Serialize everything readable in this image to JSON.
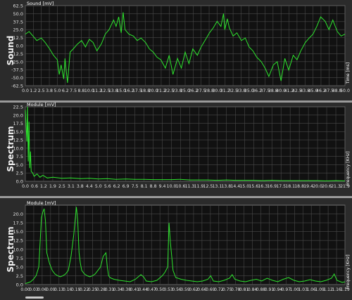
{
  "charts": [
    {
      "sidebar_label": "Sound",
      "chart_data": {
        "type": "line",
        "ylabel": "Sound [mV]",
        "xlabel": "Time [ms]",
        "ylim": [
          -62.5,
          62.5
        ],
        "yticks": [
          62.5,
          50.0,
          37.5,
          25.0,
          12.5,
          0.0,
          -12.5,
          -25.0,
          -37.5,
          -50.0,
          -62.5
        ],
        "xlim": [
          0,
          50.0
        ],
        "xticks": [
          "0.0",
          "1.2",
          "2.5",
          "3.8",
          "5.0",
          "6.2",
          "7.5",
          "8.8",
          "10.0",
          "11.2",
          "12.5",
          "13.8",
          "15.0",
          "16.2",
          "17.5",
          "18.8",
          "20.0",
          "21.2",
          "22.5",
          "23.8",
          "25.0",
          "26.2",
          "27.5",
          "28.8",
          "30.0",
          "31.2",
          "32.5",
          "33.8",
          "35.0",
          "36.2",
          "37.5",
          "38.8",
          "40.0",
          "41.2",
          "42.5",
          "43.8",
          "45.0",
          "46.2",
          "47.5",
          "48.8",
          "50.0"
        ],
        "grid": true,
        "line_color": "#2ee52e",
        "x": [
          0,
          0.6,
          1.2,
          1.8,
          2.5,
          3.1,
          3.8,
          4.4,
          5.0,
          5.3,
          5.6,
          6.0,
          6.2,
          6.6,
          7.0,
          7.5,
          8.1,
          8.8,
          9.4,
          10.0,
          10.6,
          11.2,
          11.9,
          12.5,
          13.1,
          13.8,
          14.2,
          14.6,
          15.0,
          15.3,
          15.6,
          16.2,
          16.9,
          17.5,
          18.1,
          18.8,
          19.4,
          20.0,
          20.6,
          21.2,
          21.9,
          22.5,
          23.1,
          23.8,
          24.4,
          25.0,
          25.6,
          26.2,
          26.9,
          27.5,
          28.1,
          28.8,
          29.4,
          30.0,
          30.6,
          31.0,
          31.2,
          31.6,
          31.9,
          32.5,
          33.1,
          33.8,
          34.4,
          35.0,
          35.6,
          36.2,
          36.9,
          37.5,
          38.1,
          38.8,
          39.4,
          40.0,
          40.6,
          41.2,
          41.9,
          42.5,
          43.1,
          43.8,
          44.4,
          45.0,
          45.6,
          46.2,
          46.9,
          47.5,
          48.1,
          48.8,
          49.4,
          50.0
        ],
        "y": [
          18,
          22,
          15,
          8,
          12,
          5,
          -5,
          -15,
          -22,
          -45,
          -30,
          -52,
          -20,
          -58,
          -10,
          -5,
          2,
          8,
          -2,
          10,
          5,
          -8,
          3,
          18,
          25,
          40,
          30,
          45,
          20,
          52,
          25,
          18,
          15,
          8,
          12,
          5,
          -5,
          -10,
          -18,
          -22,
          -35,
          -15,
          -45,
          -20,
          -35,
          -10,
          -28,
          -5,
          -15,
          -2,
          8,
          20,
          28,
          38,
          30,
          50,
          25,
          42,
          28,
          15,
          20,
          8,
          12,
          -2,
          -8,
          -18,
          -25,
          -35,
          -48,
          -30,
          -25,
          -55,
          -20,
          -38,
          -15,
          -22,
          -8,
          5,
          12,
          18,
          30,
          45,
          38,
          25,
          40,
          22,
          15,
          18
        ]
      }
    },
    {
      "sidebar_label": "Spectrum",
      "chart_data": {
        "type": "line",
        "ylabel": "Module [mV]",
        "xlabel": "Frequency [KHz]",
        "ylim": [
          0,
          22.5
        ],
        "yticks": [
          22.5,
          20.0,
          17.5,
          15.0,
          12.5,
          10.0,
          7.5,
          5.0,
          2.5,
          0.0
        ],
        "xlim": [
          0,
          21.9
        ],
        "xticks": [
          "0.0",
          "0.6",
          "1.2",
          "1.9",
          "2.5",
          "3.1",
          "3.8",
          "4.4",
          "5.0",
          "5.6",
          "6.2",
          "6.9",
          "7.5",
          "8.1",
          "8.8",
          "9.4",
          "10.0",
          "10.6",
          "11.3",
          "11.9",
          "12.5",
          "13.1",
          "13.8",
          "14.4",
          "15.0",
          "15.6",
          "16.3",
          "16.9",
          "17.5",
          "18.1",
          "18.8",
          "19.4",
          "20.0",
          "20.6",
          "21.3",
          "21.9"
        ],
        "grid": true,
        "line_color": "#2ee52e",
        "x": [
          0,
          0.1,
          0.15,
          0.2,
          0.25,
          0.3,
          0.35,
          0.4,
          0.5,
          0.6,
          0.8,
          1.0,
          1.2,
          1.5,
          1.9,
          2.5,
          3.1,
          3.8,
          4.4,
          5.0,
          5.6,
          6.2,
          6.9,
          7.5,
          8.1,
          8.8,
          9.4,
          10.0,
          10.6,
          11.3,
          11.9,
          12.5,
          13.1,
          13.8,
          14.4,
          15.0,
          15.6,
          16.3,
          16.9,
          17.5,
          18.1,
          18.8,
          19.4,
          20.0,
          20.6,
          21.3,
          21.9
        ],
        "y": [
          21.5,
          12,
          22.5,
          6,
          18,
          4,
          9,
          3,
          2.5,
          1.5,
          2.2,
          1.2,
          1.8,
          1.0,
          1.2,
          0.9,
          1.0,
          0.8,
          0.9,
          0.7,
          0.8,
          0.6,
          0.7,
          0.6,
          0.6,
          0.5,
          0.5,
          0.5,
          0.6,
          0.4,
          0.4,
          0.4,
          0.3,
          0.4,
          0.3,
          0.3,
          0.3,
          0.2,
          0.3,
          0.2,
          0.2,
          0.2,
          0.2,
          0.2,
          0.1,
          0.2,
          0.1
        ]
      }
    },
    {
      "sidebar_label": "Spectrum",
      "chart_data": {
        "type": "line",
        "ylabel": "Module [mV]",
        "xlabel": "Frequency [KHz]",
        "ylim": [
          0,
          22.5
        ],
        "yticks": [
          20.0,
          17.5,
          15.0,
          12.5,
          10.0,
          7.5,
          5.0,
          2.5,
          0.0
        ],
        "xlim": [
          0,
          1.19
        ],
        "xticks": [
          "0.00",
          "0.03",
          "0.06",
          "0.09",
          "0.13",
          "0.16",
          "0.19",
          "0.22",
          "0.25",
          "0.28",
          "0.31",
          "0.34",
          "0.38",
          "0.41",
          "0.44",
          "0.47",
          "0.50",
          "0.53",
          "0.56",
          "0.59",
          "0.62",
          "0.66",
          "0.69",
          "0.72",
          "0.75",
          "0.78",
          "0.81",
          "0.84",
          "0.88",
          "0.91",
          "0.94",
          "0.97",
          "1.00",
          "1.03",
          "1.06",
          "1.09",
          "1.12",
          "1.16",
          "1.19"
        ],
        "grid": true,
        "line_color": "#2ee52e",
        "x": [
          0,
          0.01,
          0.02,
          0.03,
          0.04,
          0.05,
          0.055,
          0.06,
          0.065,
          0.07,
          0.075,
          0.08,
          0.09,
          0.1,
          0.11,
          0.12,
          0.13,
          0.14,
          0.15,
          0.16,
          0.17,
          0.18,
          0.19,
          0.195,
          0.2,
          0.205,
          0.21,
          0.22,
          0.23,
          0.24,
          0.25,
          0.26,
          0.27,
          0.28,
          0.29,
          0.3,
          0.305,
          0.31,
          0.315,
          0.32,
          0.33,
          0.35,
          0.37,
          0.39,
          0.41,
          0.43,
          0.44,
          0.45,
          0.47,
          0.49,
          0.51,
          0.52,
          0.53,
          0.535,
          0.54,
          0.55,
          0.56,
          0.58,
          0.6,
          0.62,
          0.64,
          0.66,
          0.68,
          0.69,
          0.7,
          0.72,
          0.74,
          0.76,
          0.77,
          0.78,
          0.8,
          0.82,
          0.84,
          0.86,
          0.88,
          0.9,
          0.92,
          0.94,
          0.96,
          0.98,
          1.0,
          1.02,
          1.04,
          1.06,
          1.08,
          1.1,
          1.12,
          1.14,
          1.15,
          1.16,
          1.18,
          1.19
        ],
        "y": [
          0.3,
          0.5,
          0.8,
          1.5,
          2.5,
          5.0,
          12,
          19,
          20.5,
          21.5,
          18,
          9,
          6,
          4,
          3,
          2.5,
          2.2,
          2.5,
          3,
          4,
          8,
          14,
          22,
          18,
          9,
          6,
          4,
          3,
          2.5,
          2.2,
          2.5,
          3,
          4,
          5,
          8,
          9,
          5,
          2.5,
          2,
          1.8,
          1.5,
          1.2,
          1.0,
          0.8,
          1.5,
          2.8,
          2.2,
          1.0,
          0.8,
          1.2,
          2.5,
          3.5,
          5,
          17.5,
          12,
          4,
          2,
          1.5,
          1.2,
          1.0,
          0.8,
          1.0,
          1.5,
          2.5,
          1.0,
          0.8,
          1.2,
          1.8,
          2.8,
          1.5,
          1.0,
          0.8,
          1.2,
          1.5,
          1.0,
          1.8,
          1.2,
          0.8,
          1.5,
          2.0,
          1.2,
          0.8,
          1.0,
          1.4,
          1.0,
          0.8,
          1.2,
          1.8,
          3.0,
          1.2,
          0.6,
          0.8
        ]
      }
    }
  ]
}
